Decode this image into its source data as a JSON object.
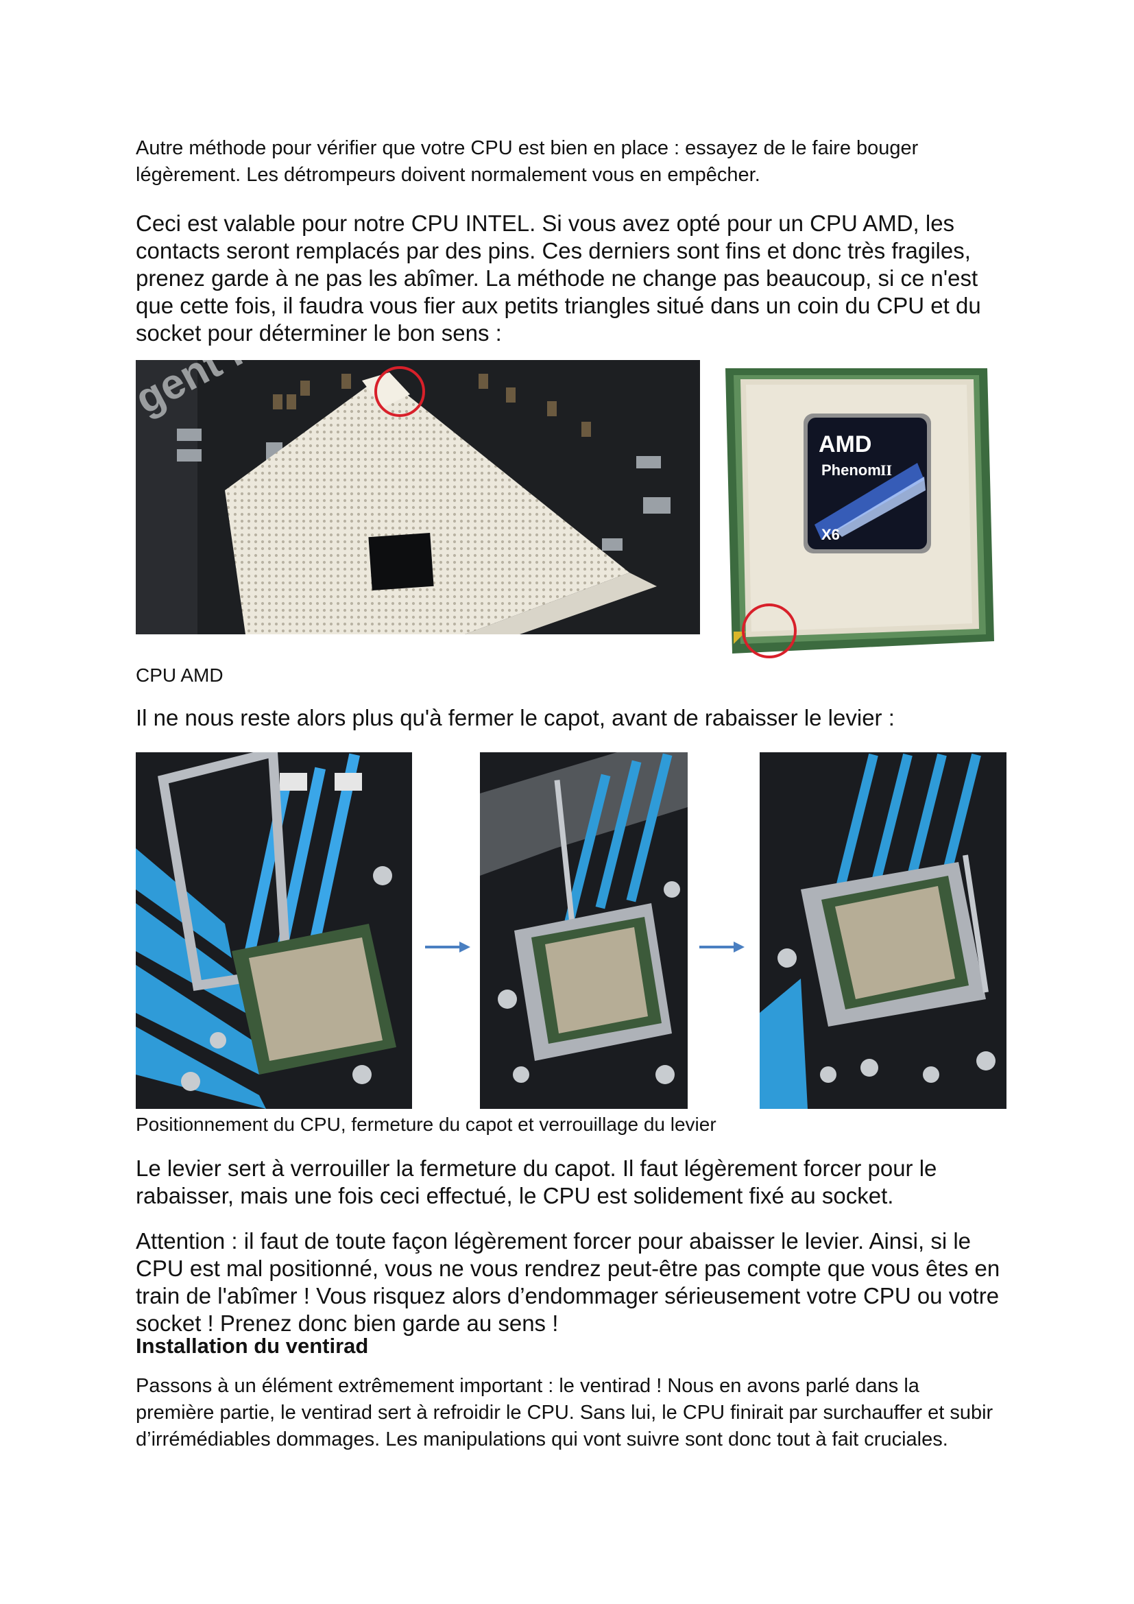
{
  "paragraphs": {
    "p1": "Autre méthode pour vérifier que votre CPU est bien en place : essayez de le faire bouger légèrement. Les détrompeurs doivent normalement vous en empêcher.",
    "p2": "Ceci est valable pour notre CPU INTEL. Si vous avez opté pour un CPU AMD, les contacts seront remplacés par des pins. Ces derniers sont fins et donc très fragiles, prenez garde à ne pas les abîmer. La méthode ne change pas beaucoup, si ce n'est que cette fois, il faudra vous fier aux petits triangles situé dans un coin du CPU et du socket pour déterminer le bon sens :",
    "p3": "Il ne nous reste alors plus qu'à fermer le capot, avant de rabaisser le levier :",
    "p4": "Le levier sert à verrouiller la fermeture du capot. Il faut légèrement forcer pour le rabaisser, mais une fois ceci effectué, le CPU est solidement fixé au socket.",
    "p5": "Attention : il faut de toute façon légèrement forcer pour abaisser le levier. Ainsi, si le CPU est mal positionné, vous ne vous rendrez peut-être pas compte que vous êtes en train de l'abîmer ! Vous risquez alors d’endommager sérieusement votre CPU ou votre socket ! Prenez donc bien garde au sens !",
    "p6": "Passons à un élément extrêmement important : le ventirad ! Nous en avons parlé dans la première partie, le ventirad sert à refroidir le CPU. Sans lui, le CPU finirait par surchauffer et subir d’irrémédiables dommages. Les manipulations qui vont suivre sont donc tout à fait cruciales."
  },
  "captions": {
    "amd": "CPU AMD",
    "sequence": "Positionnement du CPU, fermeture du capot et verrouillage du levier"
  },
  "heading": "Installation du ventirad",
  "amd_chip": {
    "brand": "AMD",
    "model": "Phenom",
    "model_suffix": "II",
    "cores": "X6",
    "board_text": "gent P"
  },
  "colors": {
    "highlight_circle": "#d8202a",
    "arrow": "#4a7fc1",
    "board_dark": "#1d1f22",
    "ram_blue": "#2f9bd8",
    "socket_cream": "#e9e4d6"
  }
}
